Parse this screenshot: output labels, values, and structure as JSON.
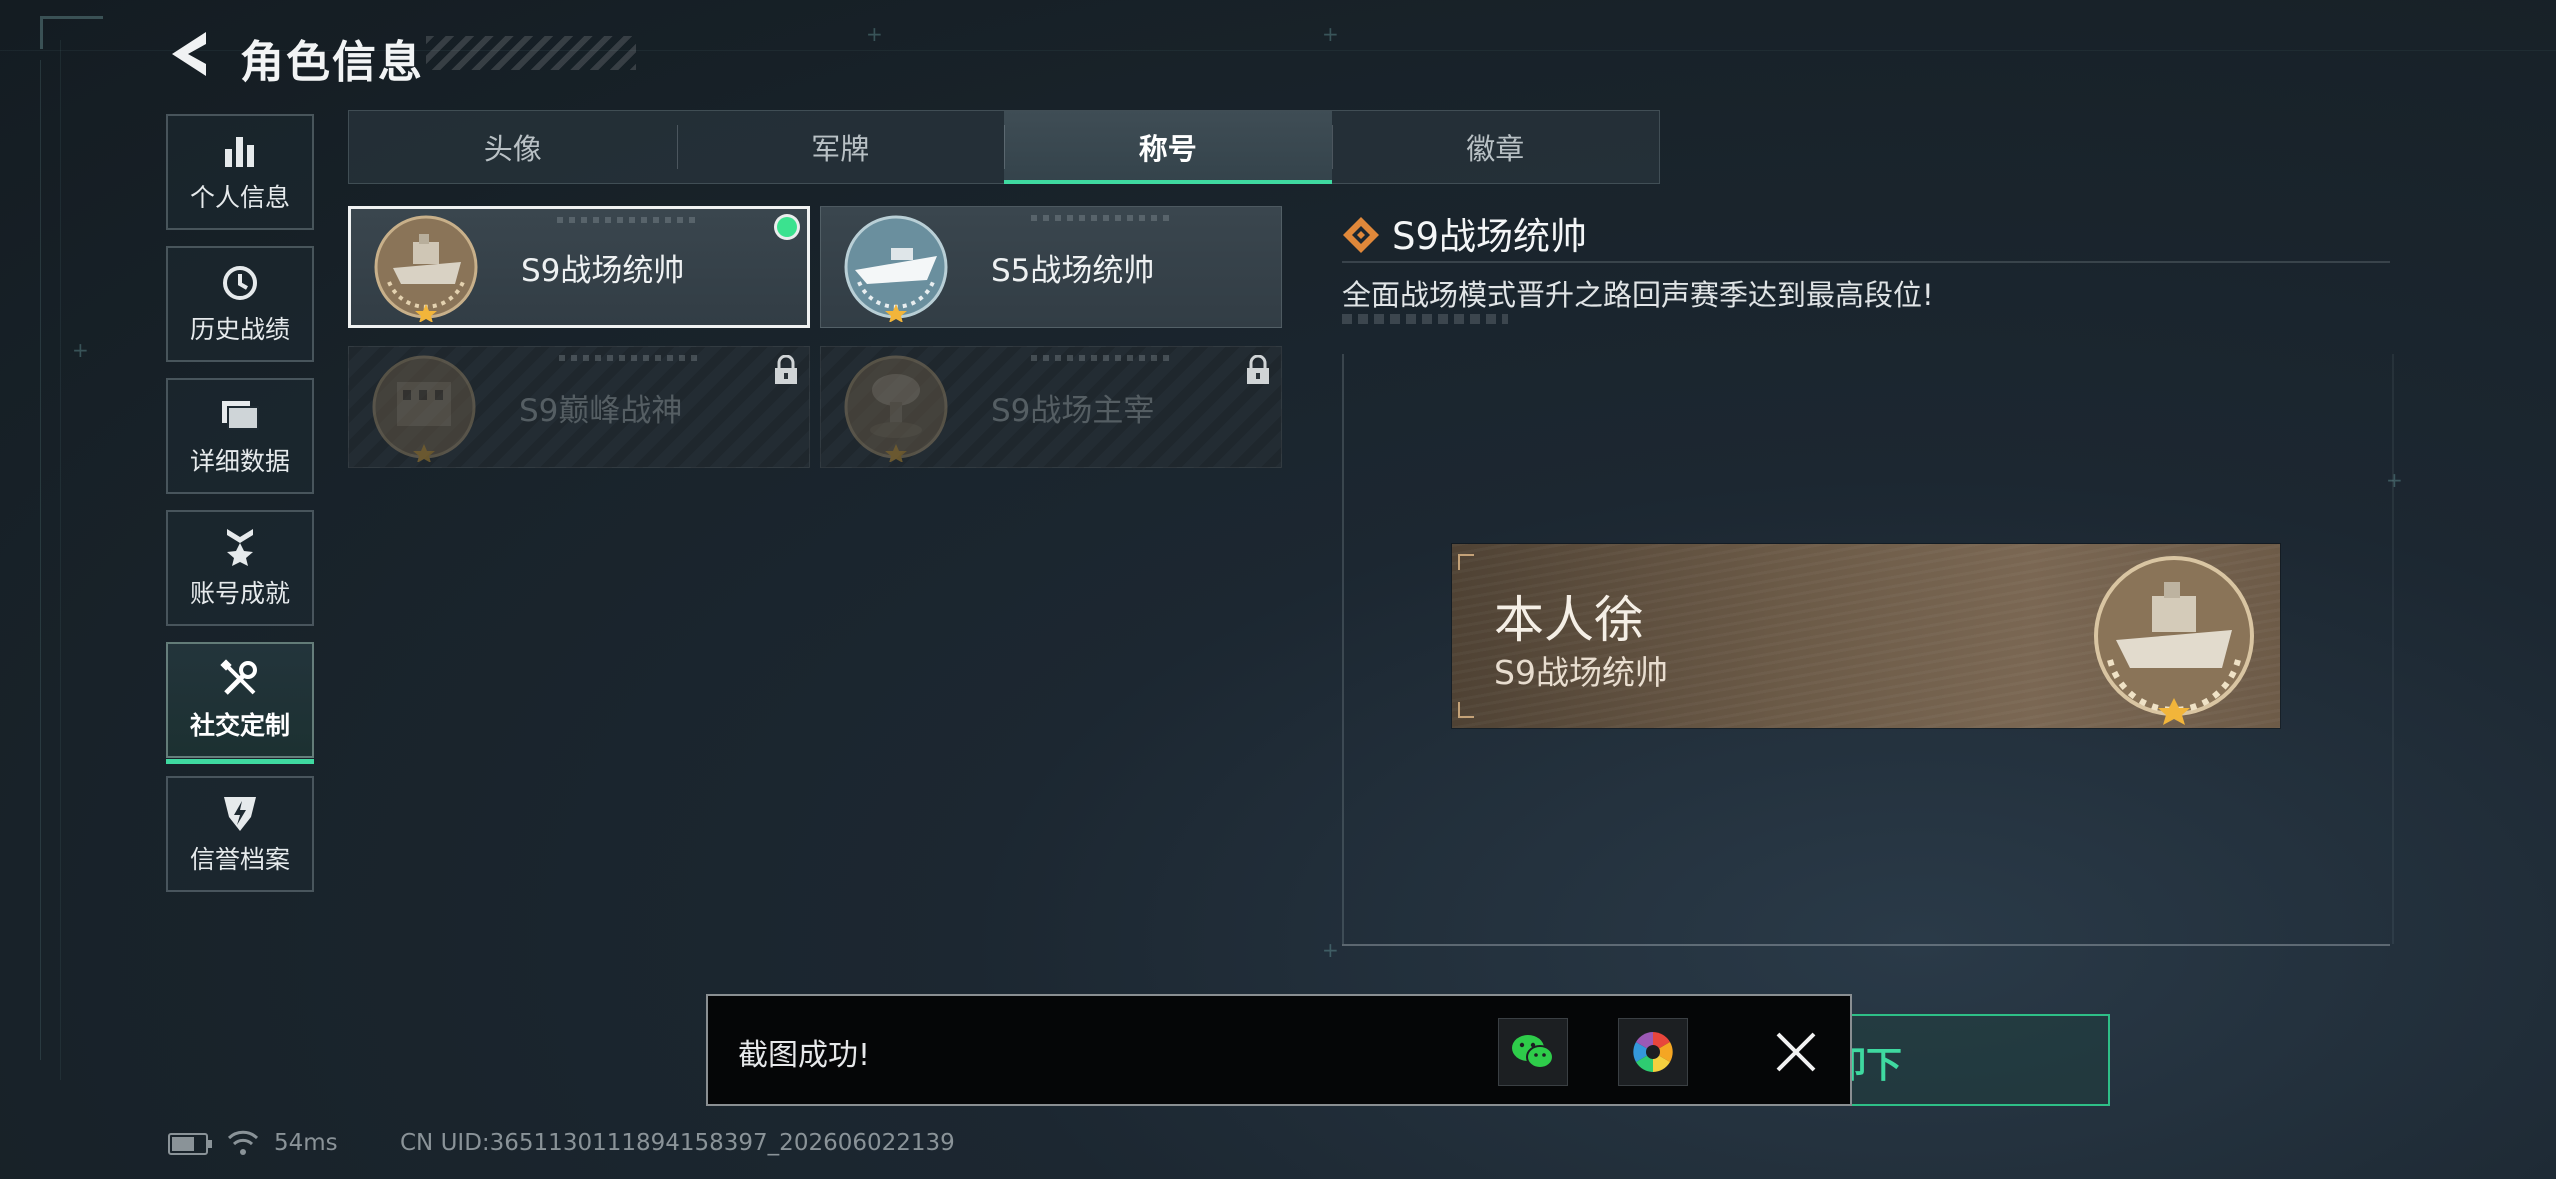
{
  "header": {
    "title": "角色信息"
  },
  "sidebar": {
    "items": [
      {
        "label": "个人信息",
        "icon": "bar-chart-icon"
      },
      {
        "label": "历史战绩",
        "icon": "clock-icon"
      },
      {
        "label": "详细数据",
        "icon": "folder-icon"
      },
      {
        "label": "账号成就",
        "icon": "medal-icon"
      },
      {
        "label": "社交定制",
        "icon": "tools-icon",
        "active": true
      },
      {
        "label": "信誉档案",
        "icon": "shield-bolt-icon"
      }
    ]
  },
  "tabs": [
    {
      "label": "头像"
    },
    {
      "label": "军牌"
    },
    {
      "label": "称号",
      "active": true
    },
    {
      "label": "徽章"
    }
  ],
  "titles": [
    {
      "name": "S9战场统帅",
      "selected": true,
      "equipped": true,
      "locked": false,
      "icon": "ship-medal-icon"
    },
    {
      "name": "S5战场统帅",
      "selected": false,
      "locked": false,
      "icon": "boat-medal-icon"
    },
    {
      "name": "S9巅峰战神",
      "selected": false,
      "locked": true,
      "icon": "building-medal-icon"
    },
    {
      "name": "S9战场主宰",
      "selected": false,
      "locked": true,
      "icon": "explosion-medal-icon"
    }
  ],
  "detail": {
    "title": "S9战场统帅",
    "description": "全面战场模式晋升之路回声赛季达到最高段位!"
  },
  "preview": {
    "player_name": "本人徐",
    "title": "S9战场统帅"
  },
  "confirm_button": {
    "label_partial": "卸下"
  },
  "toast": {
    "message": "截图成功!",
    "share_wechat_icon": "wechat-icon",
    "share_album_icon": "color-wheel-icon",
    "close_icon": "close-icon"
  },
  "status_bar": {
    "ping": "54ms",
    "uid": "CN UID:3651130111894158397_202606022139"
  },
  "colors": {
    "accent": "#3fd9a0",
    "toast_bg": "#050607",
    "plate_bg": "#6b5a47",
    "detail_icon": "#e0883a"
  }
}
